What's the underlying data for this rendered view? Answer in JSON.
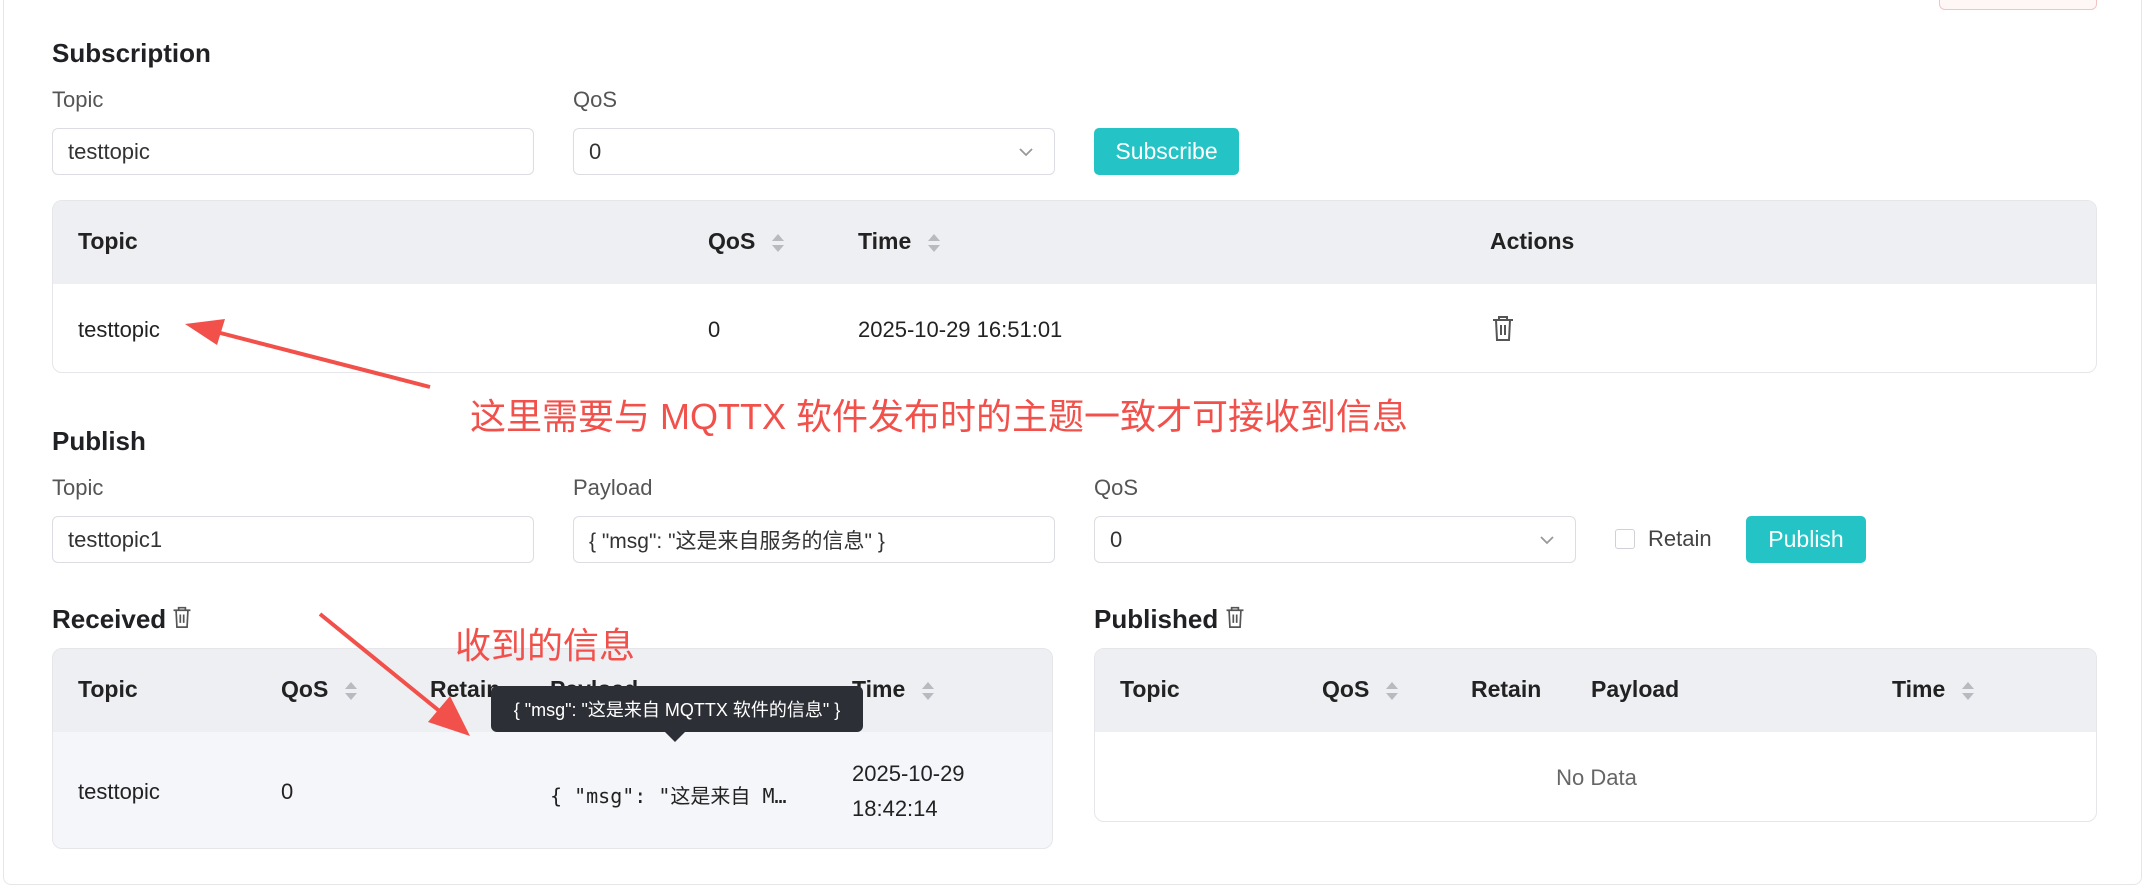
{
  "subscription": {
    "title": "Subscription",
    "topic_label": "Topic",
    "topic_value": "testtopic",
    "qos_label": "QoS",
    "qos_value": "0",
    "subscribe_label": "Subscribe",
    "table": {
      "headers": {
        "topic": "Topic",
        "qos": "QoS",
        "time": "Time",
        "actions": "Actions"
      },
      "rows": [
        {
          "topic": "testtopic",
          "qos": "0",
          "time": "2025-10-29 16:51:01"
        }
      ]
    }
  },
  "annotation_1": "这里需要与 MQTTX 软件发布时的主题一致才可接收到信息",
  "publish": {
    "title": "Publish",
    "topic_label": "Topic",
    "topic_value": "testtopic1",
    "payload_label": "Payload",
    "payload_value": "{ \"msg\": \"这是来自服务的信息\" }",
    "qos_label": "QoS",
    "qos_value": "0",
    "retain_label": "Retain",
    "publish_label": "Publish"
  },
  "received": {
    "title": "Received",
    "headers": {
      "topic": "Topic",
      "qos": "QoS",
      "retain": "Retain",
      "payload": "Payload",
      "time": "Time"
    },
    "rows": [
      {
        "topic": "testtopic",
        "qos": "0",
        "payload": "{ \"msg\": \"这是来自 M…",
        "time_date": "2025-10-29",
        "time_clock": "18:42:14"
      }
    ],
    "tooltip": "{ \"msg\": \"这是来自 MQTTX 软件的信息\" }"
  },
  "annotation_2": "收到的信息",
  "published": {
    "title": "Published",
    "headers": {
      "topic": "Topic",
      "qos": "QoS",
      "retain": "Retain",
      "payload": "Payload",
      "time": "Time"
    },
    "empty_text": "No Data"
  },
  "colors": {
    "accent": "#24c4c6",
    "annotation": "#f1504b",
    "header_bg": "#eeeff3",
    "tooltip_bg": "#2d2f36"
  }
}
